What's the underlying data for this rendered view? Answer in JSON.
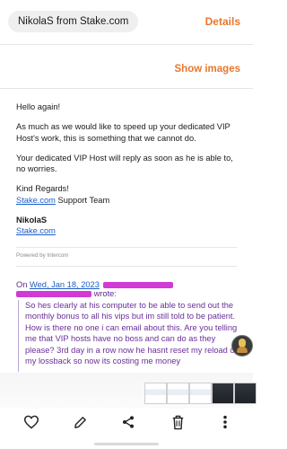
{
  "header": {
    "sender": "NikolaS from Stake.com",
    "details_label": "Details"
  },
  "images": {
    "show_images_label": "Show images"
  },
  "email": {
    "greeting": "Hello again!",
    "para1": "As much as we would like to speed up your dedicated VIP Host's work, this is something that we cannot do.",
    "para2": "Your dedicated VIP Host will reply as soon as he is able to, no worries.",
    "closing": "Kind Regards!",
    "team_link": "Stake.com",
    "team_text": " Support Team",
    "sig_name": "NikolaS",
    "sig_link": "Stake.com",
    "powered_by": "Powered by Intercom"
  },
  "quote": {
    "on": "On",
    "date": "Wed, Jan 18, 2023",
    "wrote": "wrote:",
    "text": "So hes clearly at his computer to be able to send out the monthly bonus to all his vips but im still told to be patient. How is there no one i can email about this. Are you telling me that VIP hosts have no boss and can do as they please? 3rd day in a row now he hasnt reset my reload or my lossback so now its costing me money"
  },
  "bottom_bar": {
    "favorite_icon": "heart-icon",
    "edit_icon": "pencil-icon",
    "share_icon": "share-icon",
    "delete_icon": "trash-icon",
    "more_icon": "more-vertical-icon"
  }
}
